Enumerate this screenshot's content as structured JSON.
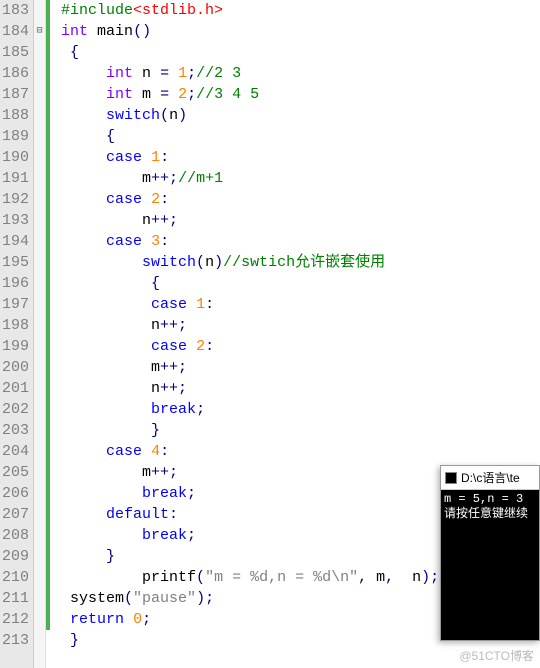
{
  "lines": [
    {
      "num": 183,
      "marker": "",
      "change": "g",
      "tokens": [
        [
          "id",
          " "
        ],
        [
          "pp",
          "#include"
        ],
        [
          "inc",
          "<stdlib.h>"
        ]
      ]
    },
    {
      "num": 184,
      "marker": "⊟",
      "change": "g",
      "tokens": [
        [
          "id",
          " "
        ],
        [
          "type",
          "int"
        ],
        [
          "id",
          " main"
        ],
        [
          "paren",
          "()"
        ]
      ]
    },
    {
      "num": 185,
      "marker": "",
      "change": "g",
      "tokens": [
        [
          "id",
          "  "
        ],
        [
          "paren",
          "{"
        ]
      ]
    },
    {
      "num": 186,
      "marker": "",
      "change": "g",
      "tokens": [
        [
          "id",
          "      "
        ],
        [
          "type",
          "int"
        ],
        [
          "id",
          " n "
        ],
        [
          "paren",
          "="
        ],
        [
          "id",
          " "
        ],
        [
          "num",
          "1"
        ],
        [
          "paren",
          ";"
        ],
        [
          "cmt",
          "//2 3"
        ]
      ]
    },
    {
      "num": 187,
      "marker": "",
      "change": "g",
      "tokens": [
        [
          "id",
          "      "
        ],
        [
          "type",
          "int"
        ],
        [
          "id",
          " m "
        ],
        [
          "paren",
          "="
        ],
        [
          "id",
          " "
        ],
        [
          "num",
          "2"
        ],
        [
          "paren",
          ";"
        ],
        [
          "cmt",
          "//3 4 5"
        ]
      ]
    },
    {
      "num": 188,
      "marker": "",
      "change": "g",
      "tokens": [
        [
          "id",
          "      "
        ],
        [
          "kw",
          "switch"
        ],
        [
          "paren",
          "("
        ],
        [
          "id",
          "n"
        ],
        [
          "paren",
          ")"
        ]
      ]
    },
    {
      "num": 189,
      "marker": "",
      "change": "g",
      "tokens": [
        [
          "id",
          "      "
        ],
        [
          "paren",
          "{"
        ]
      ]
    },
    {
      "num": 190,
      "marker": "",
      "change": "g",
      "tokens": [
        [
          "id",
          "      "
        ],
        [
          "kw",
          "case"
        ],
        [
          "id",
          " "
        ],
        [
          "num",
          "1"
        ],
        [
          "paren",
          ":"
        ]
      ]
    },
    {
      "num": 191,
      "marker": "",
      "change": "g",
      "tokens": [
        [
          "id",
          "          m"
        ],
        [
          "paren",
          "++;"
        ],
        [
          "cmt",
          "//m+1"
        ]
      ]
    },
    {
      "num": 192,
      "marker": "",
      "change": "g",
      "tokens": [
        [
          "id",
          "      "
        ],
        [
          "kw",
          "case"
        ],
        [
          "id",
          " "
        ],
        [
          "num",
          "2"
        ],
        [
          "paren",
          ":"
        ]
      ]
    },
    {
      "num": 193,
      "marker": "",
      "change": "g",
      "tokens": [
        [
          "id",
          "          n"
        ],
        [
          "paren",
          "++;"
        ]
      ]
    },
    {
      "num": 194,
      "marker": "",
      "change": "g",
      "tokens": [
        [
          "id",
          "      "
        ],
        [
          "kw",
          "case"
        ],
        [
          "id",
          " "
        ],
        [
          "num",
          "3"
        ],
        [
          "paren",
          ":"
        ]
      ]
    },
    {
      "num": 195,
      "marker": "",
      "change": "g",
      "tokens": [
        [
          "id",
          "          "
        ],
        [
          "kw",
          "switch"
        ],
        [
          "paren",
          "("
        ],
        [
          "id",
          "n"
        ],
        [
          "paren",
          ")"
        ],
        [
          "cmt",
          "//swtich允许嵌套使用"
        ]
      ]
    },
    {
      "num": 196,
      "marker": "",
      "change": "g",
      "tokens": [
        [
          "id",
          "           "
        ],
        [
          "paren",
          "{"
        ]
      ]
    },
    {
      "num": 197,
      "marker": "",
      "change": "g",
      "tokens": [
        [
          "id",
          "           "
        ],
        [
          "kw",
          "case"
        ],
        [
          "id",
          " "
        ],
        [
          "num",
          "1"
        ],
        [
          "paren",
          ":"
        ]
      ]
    },
    {
      "num": 198,
      "marker": "",
      "change": "g",
      "tokens": [
        [
          "id",
          "           n"
        ],
        [
          "paren",
          "++;"
        ]
      ]
    },
    {
      "num": 199,
      "marker": "",
      "change": "g",
      "tokens": [
        [
          "id",
          "           "
        ],
        [
          "kw",
          "case"
        ],
        [
          "id",
          " "
        ],
        [
          "num",
          "2"
        ],
        [
          "paren",
          ":"
        ]
      ]
    },
    {
      "num": 200,
      "marker": "",
      "change": "g",
      "tokens": [
        [
          "id",
          "           m"
        ],
        [
          "paren",
          "++;"
        ]
      ]
    },
    {
      "num": 201,
      "marker": "",
      "change": "g",
      "tokens": [
        [
          "id",
          "           n"
        ],
        [
          "paren",
          "++;"
        ]
      ]
    },
    {
      "num": 202,
      "marker": "",
      "change": "g",
      "tokens": [
        [
          "id",
          "           "
        ],
        [
          "kw",
          "break"
        ],
        [
          "paren",
          ";"
        ]
      ]
    },
    {
      "num": 203,
      "marker": "",
      "change": "g",
      "tokens": [
        [
          "id",
          "           "
        ],
        [
          "paren",
          "}"
        ]
      ]
    },
    {
      "num": 204,
      "marker": "",
      "change": "g",
      "tokens": [
        [
          "id",
          "      "
        ],
        [
          "kw",
          "case"
        ],
        [
          "id",
          " "
        ],
        [
          "num",
          "4"
        ],
        [
          "paren",
          ":"
        ]
      ]
    },
    {
      "num": 205,
      "marker": "",
      "change": "g",
      "tokens": [
        [
          "id",
          "          m"
        ],
        [
          "paren",
          "++;"
        ]
      ]
    },
    {
      "num": 206,
      "marker": "",
      "change": "g",
      "tokens": [
        [
          "id",
          "          "
        ],
        [
          "kw",
          "break"
        ],
        [
          "paren",
          ";"
        ]
      ]
    },
    {
      "num": 207,
      "marker": "",
      "change": "g",
      "tokens": [
        [
          "id",
          "      "
        ],
        [
          "kw",
          "default"
        ],
        [
          "paren",
          ":"
        ]
      ]
    },
    {
      "num": 208,
      "marker": "",
      "change": "g",
      "tokens": [
        [
          "id",
          "          "
        ],
        [
          "kw",
          "break"
        ],
        [
          "paren",
          ";"
        ]
      ]
    },
    {
      "num": 209,
      "marker": "",
      "change": "g",
      "tokens": [
        [
          "id",
          "      "
        ],
        [
          "paren",
          "}"
        ]
      ]
    },
    {
      "num": 210,
      "marker": "",
      "change": "g",
      "tokens": [
        [
          "id",
          "          printf"
        ],
        [
          "paren",
          "("
        ],
        [
          "str",
          "\"m = %d,n = %d\\n\""
        ],
        [
          "paren",
          ","
        ],
        [
          "id",
          " m"
        ],
        [
          "paren",
          ","
        ],
        [
          "id",
          "  n"
        ],
        [
          "paren",
          ");"
        ]
      ]
    },
    {
      "num": 211,
      "marker": "",
      "change": "g",
      "tokens": [
        [
          "id",
          "  system"
        ],
        [
          "paren",
          "("
        ],
        [
          "str",
          "\"pause\""
        ],
        [
          "paren",
          ");"
        ]
      ]
    },
    {
      "num": 212,
      "marker": "",
      "change": "g",
      "tokens": [
        [
          "id",
          "  "
        ],
        [
          "kw",
          "return"
        ],
        [
          "id",
          " "
        ],
        [
          "num",
          "0"
        ],
        [
          "paren",
          ";"
        ]
      ]
    },
    {
      "num": 213,
      "marker": "",
      "change": "",
      "tokens": [
        [
          "id",
          "  "
        ],
        [
          "paren",
          "}"
        ]
      ]
    }
  ],
  "console": {
    "title": "D:\\c语言\\te",
    "output_line1": "m = 5,n = 3",
    "output_line2": "请按任意键继续"
  },
  "watermark": "@51CTO博客"
}
